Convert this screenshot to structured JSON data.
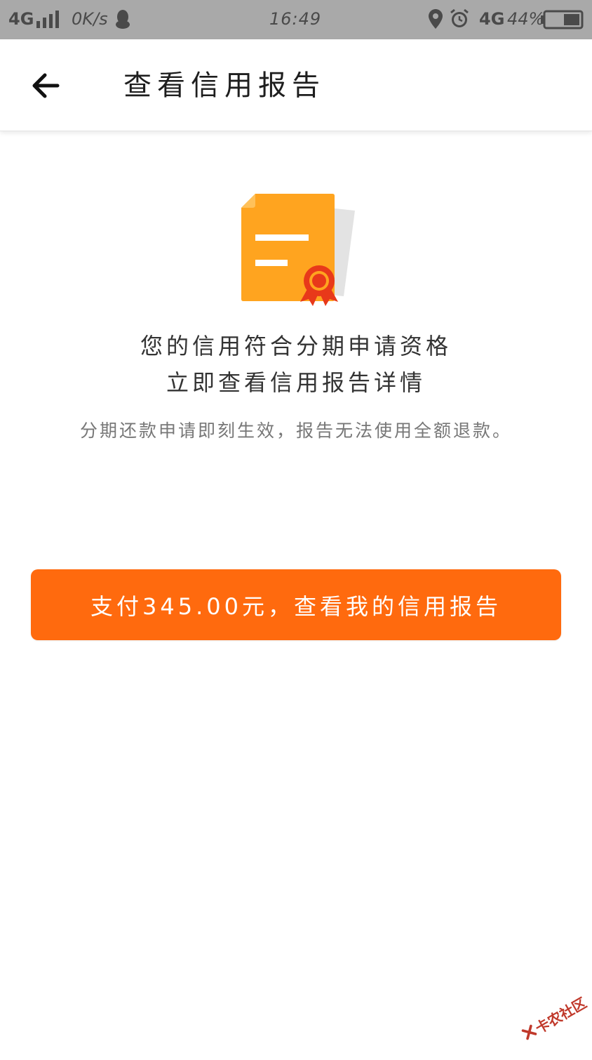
{
  "status_bar": {
    "network": "4G",
    "speed": "0K/s",
    "time": "16:49",
    "network_right": "4G",
    "battery": "44%"
  },
  "app_bar": {
    "title": "查看信用报告",
    "back_icon": "arrow-left-icon"
  },
  "content": {
    "illustration_icon": "credit-report-icon",
    "headline_line1": "您的信用符合分期申请资格",
    "headline_line2": "立即查看信用报告详情",
    "notice": "分期还款申请即刻生效，报告无法使用全额退款。"
  },
  "pay_button": {
    "label": "支付345.00元，查看我的信用报告"
  },
  "watermark": {
    "text": "卡农社区"
  },
  "colors": {
    "accent": "#ff6a0e",
    "document": "#ffa41f",
    "seal": "#e8391a",
    "status_bar_bg": "#a9a9a9"
  }
}
